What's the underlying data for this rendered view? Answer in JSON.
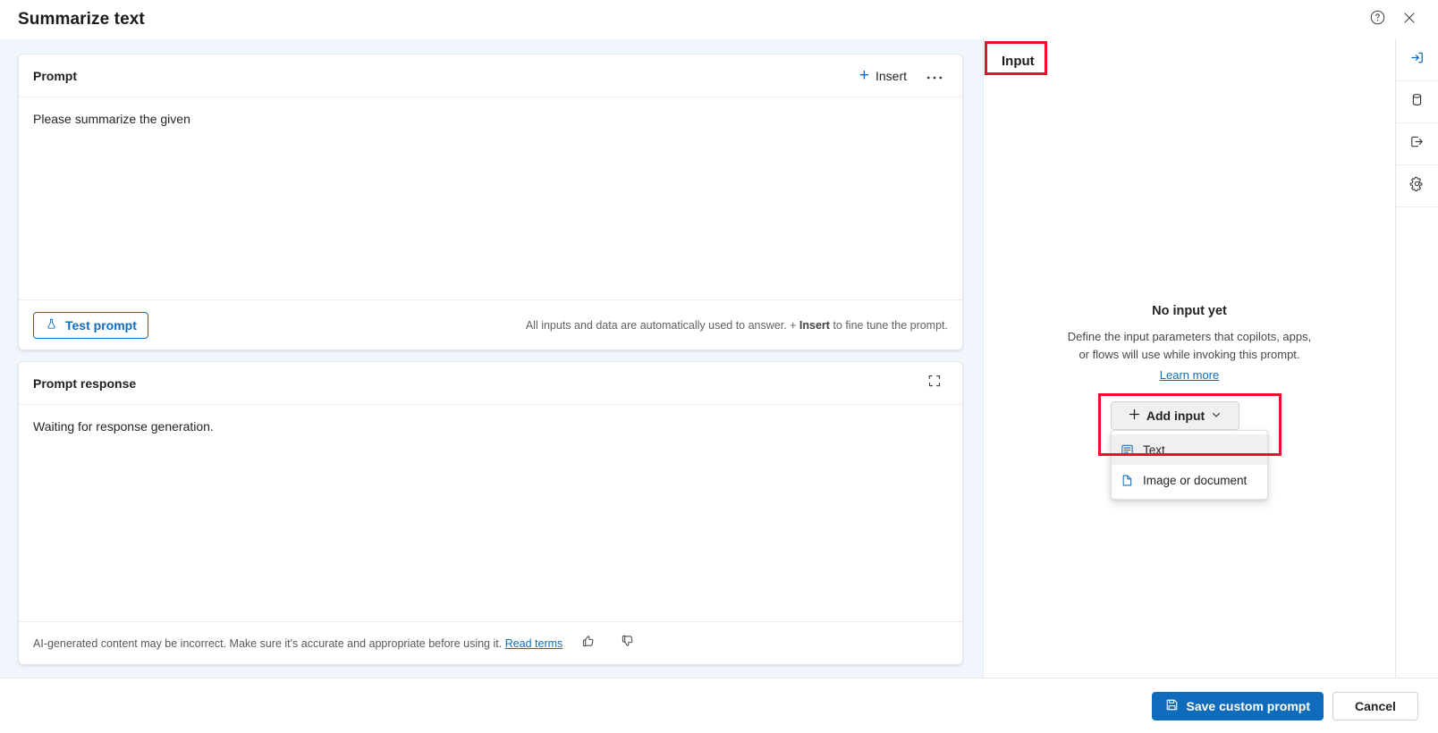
{
  "window": {
    "title": "Summarize text",
    "help_icon": "help-circle-icon",
    "close_icon": "close-icon"
  },
  "prompt_card": {
    "title": "Prompt",
    "insert_label": "Insert",
    "more_label": "···",
    "text": "Please summarize the given",
    "test_button_label": "Test prompt",
    "hint_prefix": "All inputs and data are automatically used to answer. + ",
    "hint_bold": "Insert",
    "hint_suffix": " to fine tune the prompt."
  },
  "response_card": {
    "title": "Prompt response",
    "expand_icon": "expand-icon",
    "text": "Waiting for response generation.",
    "disclaimer": "AI-generated content may be incorrect. Make sure it's accurate and appropriate before using it. ",
    "disclaimer_link": "Read terms",
    "thumb_up_icon": "thumb-up-icon",
    "thumb_down_icon": "thumb-down-icon"
  },
  "input_panel": {
    "title": "Input",
    "empty_title": "No input yet",
    "empty_desc_line1": "Define the input parameters that copilots, apps,",
    "empty_desc_line2": "or flows will use while invoking this prompt.",
    "learn_more": "Learn more",
    "add_input_label": "Add input",
    "menu": [
      {
        "label": "Text",
        "icon": "text-lines-icon"
      },
      {
        "label": "Image or document",
        "icon": "document-icon"
      }
    ]
  },
  "rail": [
    {
      "name": "input",
      "icon": "arrow-into-box-icon",
      "active": true
    },
    {
      "name": "data",
      "icon": "database-icon",
      "active": false
    },
    {
      "name": "output",
      "icon": "arrow-out-of-box-icon",
      "active": false
    },
    {
      "name": "settings",
      "icon": "gear-icon",
      "active": false
    }
  ],
  "bottom_bar": {
    "save_label": "Save custom prompt",
    "save_icon": "save-disk-icon",
    "cancel_label": "Cancel"
  },
  "colors": {
    "accent": "#0f6cbd",
    "highlight": "#e8112d",
    "canvas": "#f1f6fd"
  }
}
